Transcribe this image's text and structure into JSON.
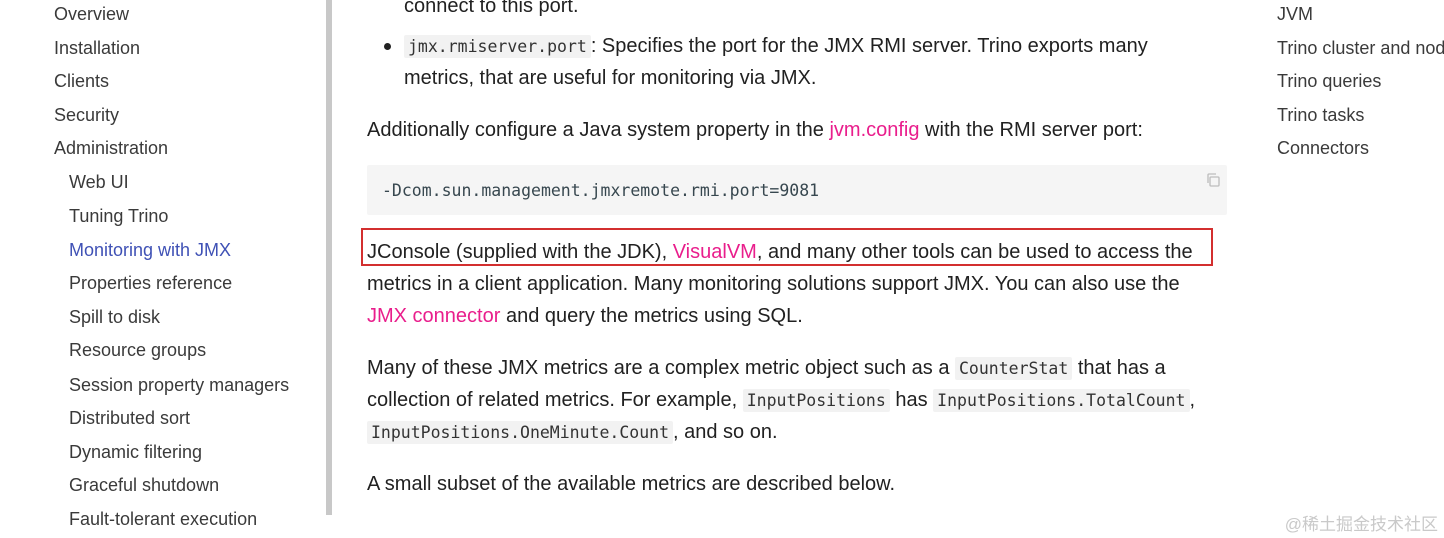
{
  "left_nav": {
    "items": [
      {
        "label": "Overview"
      },
      {
        "label": "Installation"
      },
      {
        "label": "Clients"
      },
      {
        "label": "Security"
      },
      {
        "label": "Administration"
      },
      {
        "label": "Web UI"
      },
      {
        "label": "Tuning Trino"
      },
      {
        "label": "Monitoring with JMX"
      },
      {
        "label": "Properties reference"
      },
      {
        "label": "Spill to disk"
      },
      {
        "label": "Resource groups"
      },
      {
        "label": "Session property managers"
      },
      {
        "label": "Distributed sort"
      },
      {
        "label": "Dynamic filtering"
      },
      {
        "label": "Graceful shutdown"
      },
      {
        "label": "Fault-tolerant execution"
      }
    ],
    "active_color": "#3f51b5"
  },
  "content": {
    "cut_line": "connect to this port.",
    "bullet_code": "jmx.rmiserver.port",
    "bullet_text_1": ": Specifies the port for the JMX RMI server. Trino exports many",
    "bullet_text_2": "metrics, that are useful for monitoring via JMX.",
    "p1_before": "Additionally configure a Java system property in the ",
    "p1_link": "jvm.config",
    "p1_after": " with the RMI server port:",
    "code_block": "-Dcom.sun.management.jmxremote.rmi.port=9081",
    "p2_l1_before": "JConsole (supplied with the JDK), ",
    "p2_l1_link": "VisualVM",
    "p2_l1_after": ", and many other tools can be used to access the",
    "p2_l2": "metrics in a client application. Many monitoring solutions support JMX. You can also use the",
    "p2_l3_link": "JMX connector",
    "p2_l3_after": " and query the metrics using SQL.",
    "p3_l1_before": "Many of these JMX metrics are a complex metric object such as a ",
    "p3_l1_code": "CounterStat",
    "p3_l1_after": " that has a",
    "p3_l2_before": "collection of related metrics. For example, ",
    "p3_l2_code1": "InputPositions",
    "p3_l2_mid": " has ",
    "p3_l2_code2": "InputPositions.TotalCount",
    "p3_l2_after": ",",
    "p3_l3_code": "InputPositions.OneMinute.Count",
    "p3_l3_after": ", and so on.",
    "p4": "A small subset of the available metrics are described below.",
    "link_color": "#e91e8c",
    "highlight_color": "#d32f2f"
  },
  "toc": {
    "items": [
      {
        "label": "JVM"
      },
      {
        "label": "Trino cluster and nodes"
      },
      {
        "label": "Trino queries"
      },
      {
        "label": "Trino tasks"
      },
      {
        "label": "Connectors"
      }
    ]
  },
  "watermark": "@稀土掘金技术社区"
}
